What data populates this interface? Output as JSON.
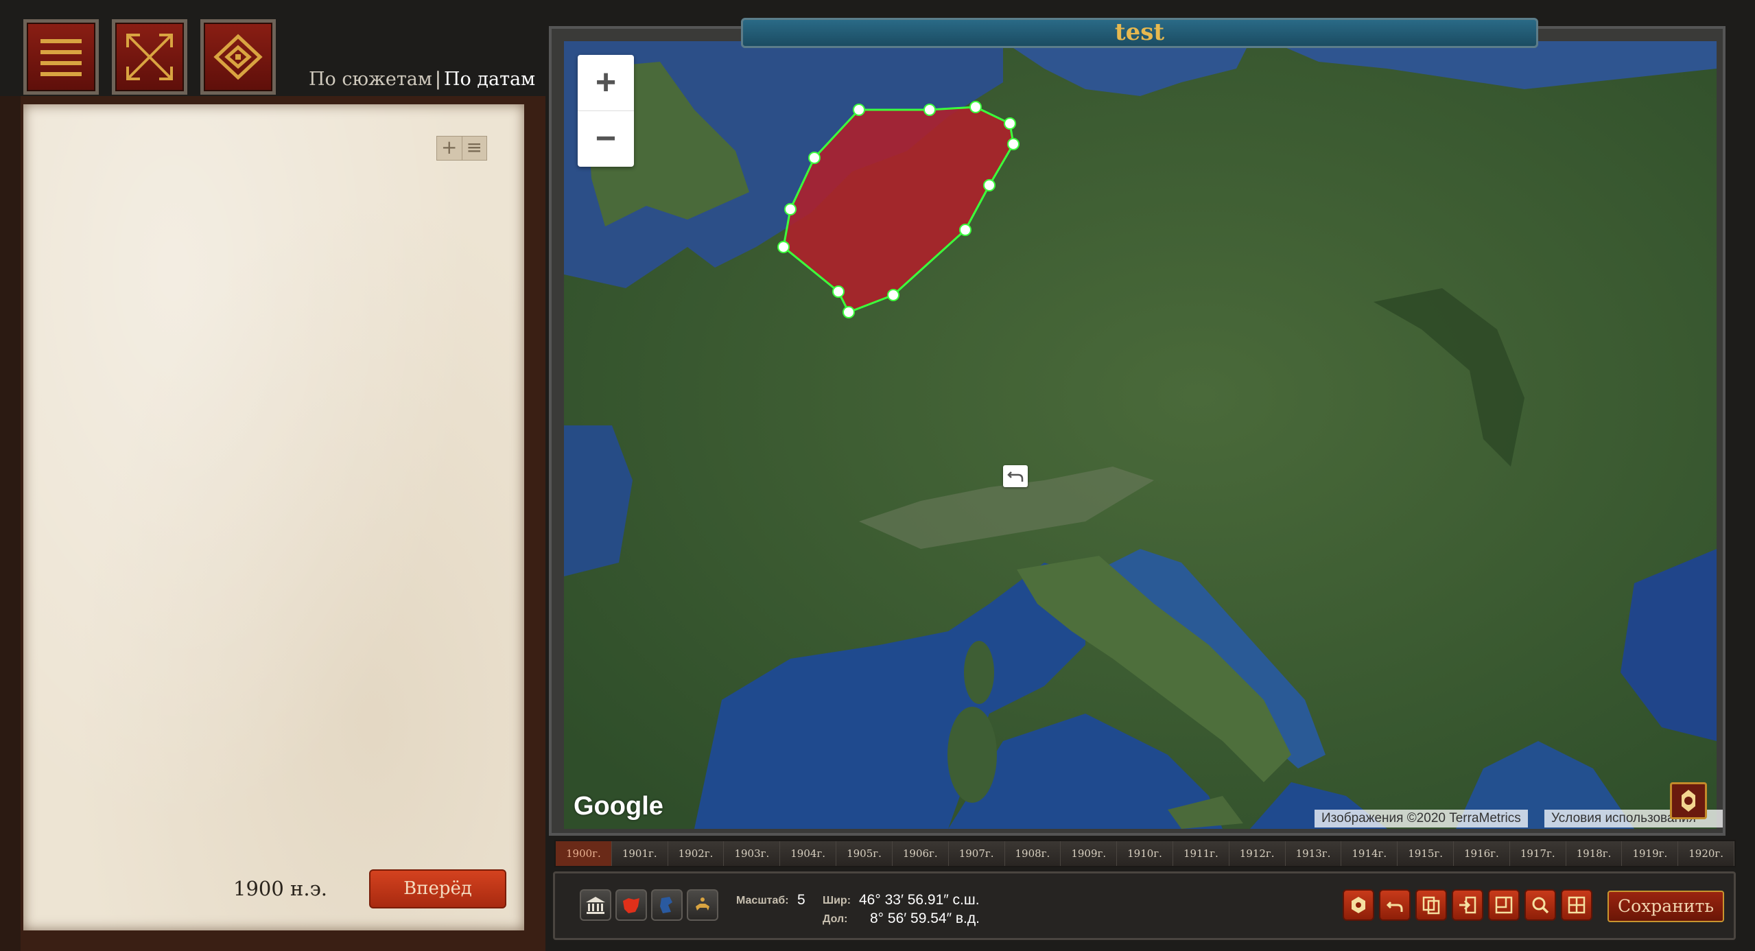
{
  "header": {
    "icons": [
      "menu-icon",
      "fullscreen-icon",
      "eye-icon"
    ],
    "view_links": {
      "by_plots": "По сюжетам",
      "separator": "|",
      "by_dates": "По датам"
    }
  },
  "left_panel": {
    "tools": [
      "+",
      "≡"
    ],
    "date": "1900 н.э.",
    "next_button": "Вперёд"
  },
  "map": {
    "title": "test",
    "zoom_in": "+",
    "zoom_out": "−",
    "provider_logo": "Google",
    "attribution": "Изображения ©2020 TerraMetrics",
    "terms": "Условия использования"
  },
  "timeline": {
    "years": [
      "1900г.",
      "1901г.",
      "1902г.",
      "1903г.",
      "1904г.",
      "1905г.",
      "1906г.",
      "1907г.",
      "1908г.",
      "1909г.",
      "1910г.",
      "1911г.",
      "1912г.",
      "1913г.",
      "1914г.",
      "1915г.",
      "1916г.",
      "1917г.",
      "1918г.",
      "1919г.",
      "1920г."
    ],
    "active_index": 0
  },
  "toolbar": {
    "scale_label": "Масштаб:",
    "scale_value": "5",
    "lat_label": "Шир:",
    "lat_value": "46° 33′ 56.91″ с.ш.",
    "lon_label": "Дол:",
    "lon_value": "8° 56′ 59.54″ в.д.",
    "save_label": "Сохранить",
    "left_icons": [
      "museum-icon",
      "territory-icon",
      "map-icon",
      "rider-icon"
    ],
    "right_icons": [
      "target-icon",
      "undo-icon",
      "copy-icon",
      "import-icon",
      "frame-icon",
      "search-icon",
      "grid-icon"
    ]
  },
  "colors": {
    "accent_red": "#a82a10",
    "polygon_fill": "#b0202a",
    "polygon_stroke": "#3cff3c",
    "title_bar": "#1b4c62",
    "title_text": "#e6b84f"
  }
}
